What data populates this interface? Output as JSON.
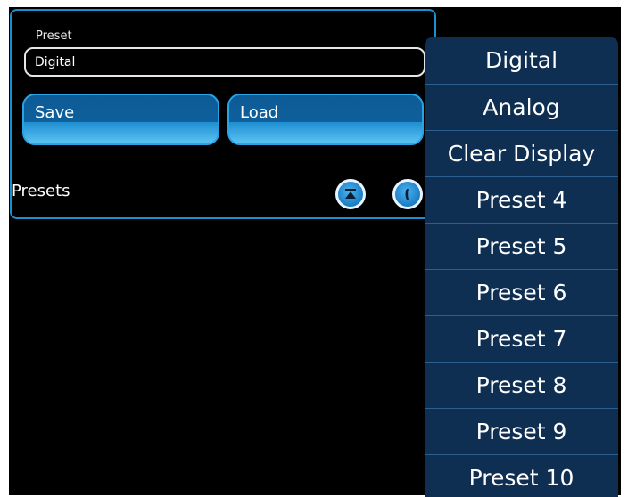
{
  "panel": {
    "preset_caption": "Preset",
    "preset_value": "Digital",
    "save_label": "Save",
    "load_label": "Load",
    "presets_label": "Presets"
  },
  "dropdown": {
    "items": [
      {
        "label": "Digital"
      },
      {
        "label": "Analog"
      },
      {
        "label": "Clear Display"
      },
      {
        "label": "Preset 4"
      },
      {
        "label": "Preset 5"
      },
      {
        "label": "Preset 6"
      },
      {
        "label": "Preset 7"
      },
      {
        "label": "Preset 8"
      },
      {
        "label": "Preset 9"
      },
      {
        "label": "Preset 10"
      }
    ]
  },
  "colors": {
    "panel_border": "#1c8fd0",
    "button_blue": "#0e5f9b",
    "dropdown_bg": "#0f2f52"
  },
  "icons": {
    "scroll_top": "scroll-to-top-icon",
    "other": "info-icon"
  }
}
